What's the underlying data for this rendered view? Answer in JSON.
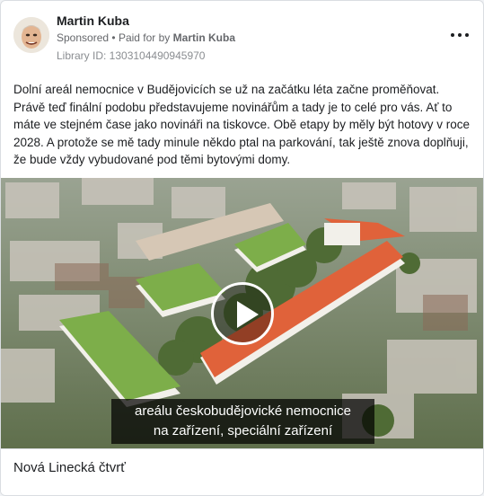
{
  "post": {
    "author": "Martin Kuba",
    "sponsored": "Sponsored",
    "separator": "•",
    "paid_for_prefix": "Paid for by",
    "paid_for_name": "Martin Kuba",
    "library_id": "Library ID: 1303104490945970",
    "text": "Dolní areál nemocnice v Budějovicích se už na začátku léta začne proměňovat. Právě teď finální podobu představujeme novinářům a tady je to celé pro vás. Ať to máte ve stejném čase jako novináři na tiskovce. Obě etapy by měly být hotovy v roce 2028. A protože se mě tady minule někdo ptal na parkování, tak ještě znova doplňuji, že bude vždy vybudované pod těmi bytovými domy."
  },
  "video": {
    "caption_line1": "areálu českobudějovické nemocnice",
    "caption_line2": "na zařízení, speciální zařízení",
    "play_icon": "play-icon"
  },
  "footer": {
    "title": "Nová Linecká čtvrť"
  },
  "colors": {
    "roof_orange": "#e0623a",
    "green_roof": "#7dae4a",
    "facade": "#f2f0ea"
  }
}
